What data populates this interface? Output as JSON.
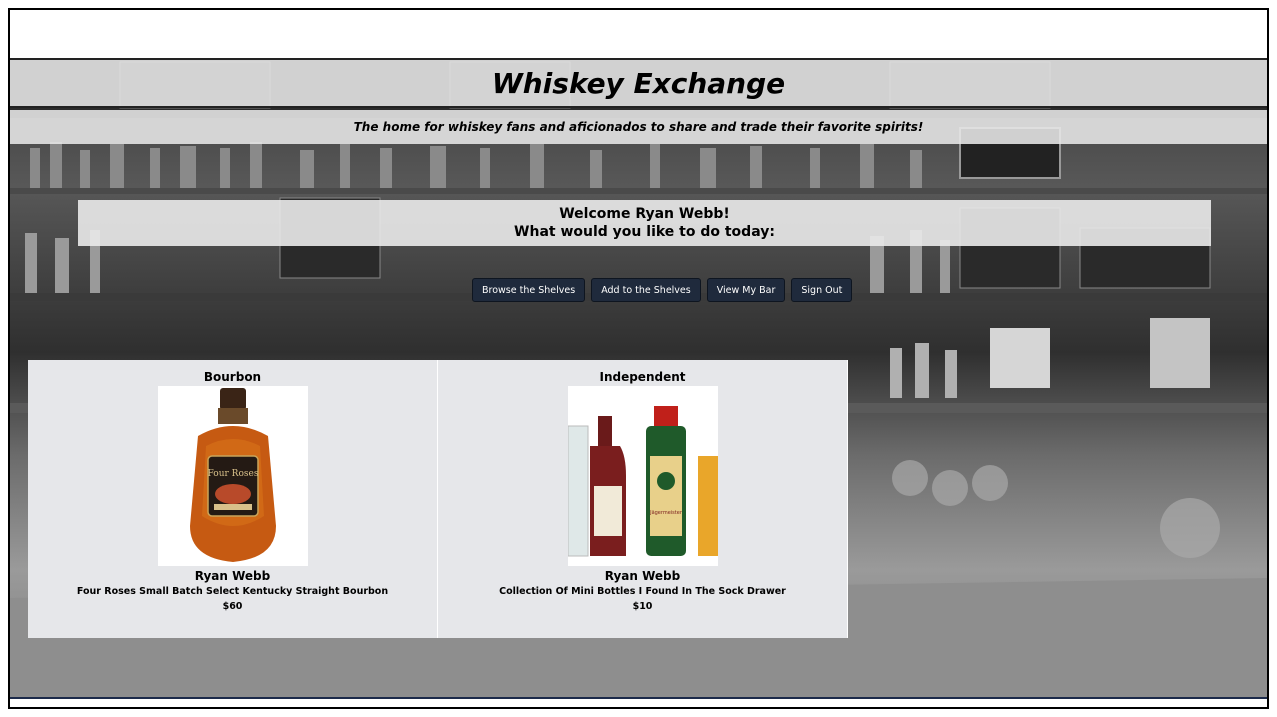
{
  "header": {
    "title": "Whiskey Exchange",
    "subtitle": "The home for whiskey fans and aficionados to share and trade their favorite spirits!"
  },
  "welcome": {
    "line1": "Welcome Ryan Webb!",
    "line2": "What would you like to do today:"
  },
  "nav": {
    "browse": "Browse the Shelves",
    "add": "Add to the Shelves",
    "my_bar": "View My Bar",
    "sign_out": "Sign Out"
  },
  "cards": [
    {
      "category": "Bourbon",
      "owner": "Ryan Webb",
      "name": "Four Roses Small Batch Select Kentucky Straight Bourbon",
      "price": "$60",
      "image_label": "Four Roses"
    },
    {
      "category": "Independent",
      "owner": "Ryan Webb",
      "name": "Collection Of Mini Bottles I Found In The Sock Drawer",
      "price": "$10",
      "image_label": "Jägermeister"
    }
  ],
  "colors": {
    "nav_button": "#1f2a3c",
    "card_bg": "#e6e7ea",
    "band_bg": "#e8e8e8"
  }
}
